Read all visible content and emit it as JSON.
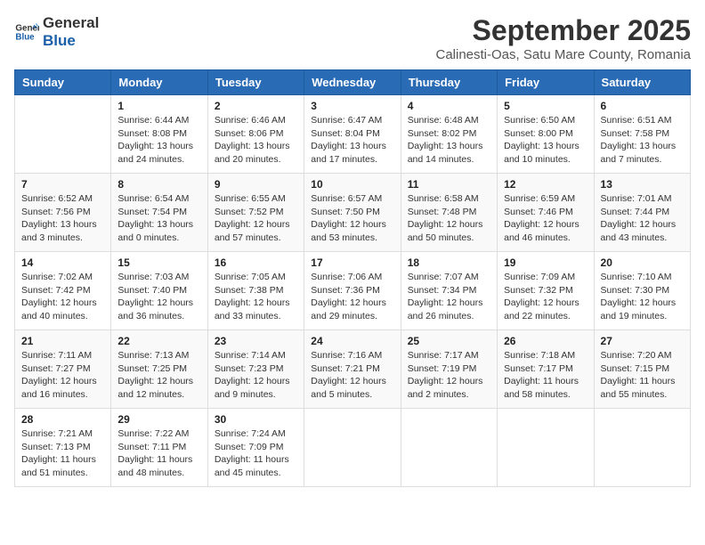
{
  "logo": {
    "line1": "General",
    "line2": "Blue"
  },
  "title": "September 2025",
  "location": "Calinesti-Oas, Satu Mare County, Romania",
  "weekdays": [
    "Sunday",
    "Monday",
    "Tuesday",
    "Wednesday",
    "Thursday",
    "Friday",
    "Saturday"
  ],
  "weeks": [
    [
      {
        "day": "",
        "detail": ""
      },
      {
        "day": "1",
        "detail": "Sunrise: 6:44 AM\nSunset: 8:08 PM\nDaylight: 13 hours\nand 24 minutes."
      },
      {
        "day": "2",
        "detail": "Sunrise: 6:46 AM\nSunset: 8:06 PM\nDaylight: 13 hours\nand 20 minutes."
      },
      {
        "day": "3",
        "detail": "Sunrise: 6:47 AM\nSunset: 8:04 PM\nDaylight: 13 hours\nand 17 minutes."
      },
      {
        "day": "4",
        "detail": "Sunrise: 6:48 AM\nSunset: 8:02 PM\nDaylight: 13 hours\nand 14 minutes."
      },
      {
        "day": "5",
        "detail": "Sunrise: 6:50 AM\nSunset: 8:00 PM\nDaylight: 13 hours\nand 10 minutes."
      },
      {
        "day": "6",
        "detail": "Sunrise: 6:51 AM\nSunset: 7:58 PM\nDaylight: 13 hours\nand 7 minutes."
      }
    ],
    [
      {
        "day": "7",
        "detail": "Sunrise: 6:52 AM\nSunset: 7:56 PM\nDaylight: 13 hours\nand 3 minutes."
      },
      {
        "day": "8",
        "detail": "Sunrise: 6:54 AM\nSunset: 7:54 PM\nDaylight: 13 hours\nand 0 minutes."
      },
      {
        "day": "9",
        "detail": "Sunrise: 6:55 AM\nSunset: 7:52 PM\nDaylight: 12 hours\nand 57 minutes."
      },
      {
        "day": "10",
        "detail": "Sunrise: 6:57 AM\nSunset: 7:50 PM\nDaylight: 12 hours\nand 53 minutes."
      },
      {
        "day": "11",
        "detail": "Sunrise: 6:58 AM\nSunset: 7:48 PM\nDaylight: 12 hours\nand 50 minutes."
      },
      {
        "day": "12",
        "detail": "Sunrise: 6:59 AM\nSunset: 7:46 PM\nDaylight: 12 hours\nand 46 minutes."
      },
      {
        "day": "13",
        "detail": "Sunrise: 7:01 AM\nSunset: 7:44 PM\nDaylight: 12 hours\nand 43 minutes."
      }
    ],
    [
      {
        "day": "14",
        "detail": "Sunrise: 7:02 AM\nSunset: 7:42 PM\nDaylight: 12 hours\nand 40 minutes."
      },
      {
        "day": "15",
        "detail": "Sunrise: 7:03 AM\nSunset: 7:40 PM\nDaylight: 12 hours\nand 36 minutes."
      },
      {
        "day": "16",
        "detail": "Sunrise: 7:05 AM\nSunset: 7:38 PM\nDaylight: 12 hours\nand 33 minutes."
      },
      {
        "day": "17",
        "detail": "Sunrise: 7:06 AM\nSunset: 7:36 PM\nDaylight: 12 hours\nand 29 minutes."
      },
      {
        "day": "18",
        "detail": "Sunrise: 7:07 AM\nSunset: 7:34 PM\nDaylight: 12 hours\nand 26 minutes."
      },
      {
        "day": "19",
        "detail": "Sunrise: 7:09 AM\nSunset: 7:32 PM\nDaylight: 12 hours\nand 22 minutes."
      },
      {
        "day": "20",
        "detail": "Sunrise: 7:10 AM\nSunset: 7:30 PM\nDaylight: 12 hours\nand 19 minutes."
      }
    ],
    [
      {
        "day": "21",
        "detail": "Sunrise: 7:11 AM\nSunset: 7:27 PM\nDaylight: 12 hours\nand 16 minutes."
      },
      {
        "day": "22",
        "detail": "Sunrise: 7:13 AM\nSunset: 7:25 PM\nDaylight: 12 hours\nand 12 minutes."
      },
      {
        "day": "23",
        "detail": "Sunrise: 7:14 AM\nSunset: 7:23 PM\nDaylight: 12 hours\nand 9 minutes."
      },
      {
        "day": "24",
        "detail": "Sunrise: 7:16 AM\nSunset: 7:21 PM\nDaylight: 12 hours\nand 5 minutes."
      },
      {
        "day": "25",
        "detail": "Sunrise: 7:17 AM\nSunset: 7:19 PM\nDaylight: 12 hours\nand 2 minutes."
      },
      {
        "day": "26",
        "detail": "Sunrise: 7:18 AM\nSunset: 7:17 PM\nDaylight: 11 hours\nand 58 minutes."
      },
      {
        "day": "27",
        "detail": "Sunrise: 7:20 AM\nSunset: 7:15 PM\nDaylight: 11 hours\nand 55 minutes."
      }
    ],
    [
      {
        "day": "28",
        "detail": "Sunrise: 7:21 AM\nSunset: 7:13 PM\nDaylight: 11 hours\nand 51 minutes."
      },
      {
        "day": "29",
        "detail": "Sunrise: 7:22 AM\nSunset: 7:11 PM\nDaylight: 11 hours\nand 48 minutes."
      },
      {
        "day": "30",
        "detail": "Sunrise: 7:24 AM\nSunset: 7:09 PM\nDaylight: 11 hours\nand 45 minutes."
      },
      {
        "day": "",
        "detail": ""
      },
      {
        "day": "",
        "detail": ""
      },
      {
        "day": "",
        "detail": ""
      },
      {
        "day": "",
        "detail": ""
      }
    ]
  ]
}
